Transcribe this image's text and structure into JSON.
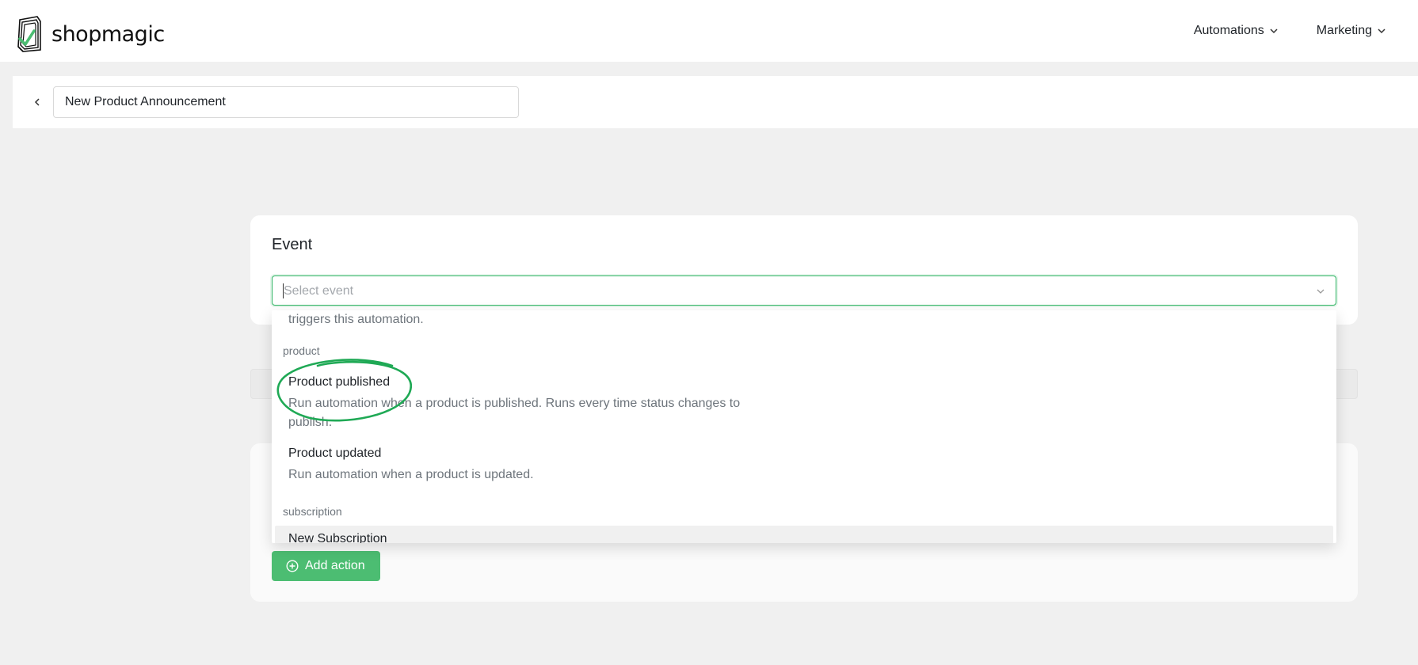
{
  "app": {
    "brand": "shopmagic",
    "accent_color": "#4cbd72",
    "focus_color": "#2fb463"
  },
  "nav": {
    "items": [
      {
        "label": "Automations",
        "icon": "chevron-down-icon"
      },
      {
        "label": "Marketing",
        "icon": "chevron-down-icon"
      }
    ]
  },
  "titlebar": {
    "back_icon": "chevron-left-icon",
    "automation_name": "New Product Announcement"
  },
  "event": {
    "heading": "Event",
    "select_placeholder": "Select event",
    "chevron_icon": "chevron-down-icon"
  },
  "dropdown": {
    "partial_desc": "triggers this automation.",
    "groups": [
      {
        "label": "product",
        "options": [
          {
            "title": "Product published",
            "desc": "Run automation when a product is published. Runs every time status changes to publish."
          },
          {
            "title": "Product updated",
            "desc": "Run automation when a product is updated."
          }
        ]
      },
      {
        "label": "subscription",
        "options": [
          {
            "title": "New Subscription"
          }
        ]
      }
    ]
  },
  "actions": {
    "add_label": "Add action",
    "add_icon": "plus-circle-icon"
  }
}
